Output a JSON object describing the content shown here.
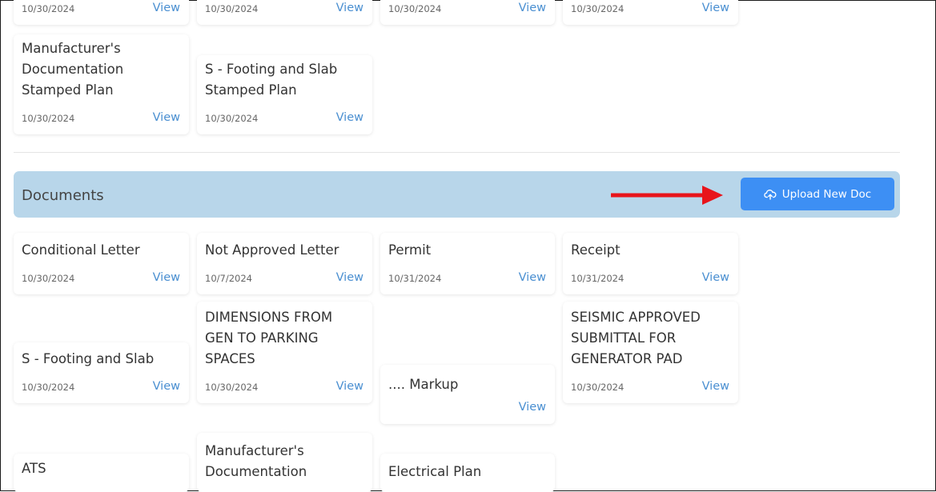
{
  "top_row": {
    "cards": [
      {
        "date": "10/30/2024",
        "view": "View"
      },
      {
        "date": "10/30/2024",
        "view": "View"
      },
      {
        "date": "10/30/2024",
        "view": "View"
      },
      {
        "date": "10/30/2024",
        "view": "View"
      }
    ]
  },
  "plans": [
    {
      "title": [
        "Manufacturer's",
        "Documentation",
        "Stamped Plan"
      ],
      "date": "10/30/2024",
      "view": "View"
    },
    {
      "title": [
        "S - Footing and Slab",
        "Stamped Plan"
      ],
      "date": "10/30/2024",
      "view": "View"
    }
  ],
  "documents": {
    "section_title": "Documents",
    "upload_label": "Upload New Doc",
    "cards": [
      {
        "title": [
          "Conditional Letter"
        ],
        "date": "10/30/2024",
        "view": "View"
      },
      {
        "title": [
          "Not Approved Letter"
        ],
        "date": "10/7/2024",
        "view": "View"
      },
      {
        "title": [
          "Permit"
        ],
        "date": "10/31/2024",
        "view": "View"
      },
      {
        "title": [
          "Receipt"
        ],
        "date": "10/31/2024",
        "view": "View"
      },
      {
        "title": [
          "S - Footing and Slab"
        ],
        "date": "10/30/2024",
        "view": "View"
      },
      {
        "title": [
          "DIMENSIONS FROM",
          "GEN TO PARKING",
          "SPACES"
        ],
        "date": "10/30/2024",
        "view": "View"
      },
      {
        "title": [
          ".... Markup"
        ],
        "view": "View"
      },
      {
        "title": [
          "SEISMIC APPROVED",
          "SUBMITTAL FOR",
          "GENERATOR PAD"
        ],
        "date": "10/30/2024",
        "view": "View"
      },
      {
        "title": [
          "ATS"
        ]
      },
      {
        "title": [
          "Manufacturer's",
          "Documentation"
        ]
      },
      {
        "title": [
          "Electrical Plan"
        ]
      }
    ]
  },
  "colors": {
    "accent": "#3d8ff4",
    "section_bg": "#b8d6ea",
    "link": "#4a8fd1",
    "annotation_arrow": "#e8141b"
  },
  "icons": {
    "upload": "cloud-upload-icon",
    "annotation": "red-arrow-annotation-icon"
  }
}
